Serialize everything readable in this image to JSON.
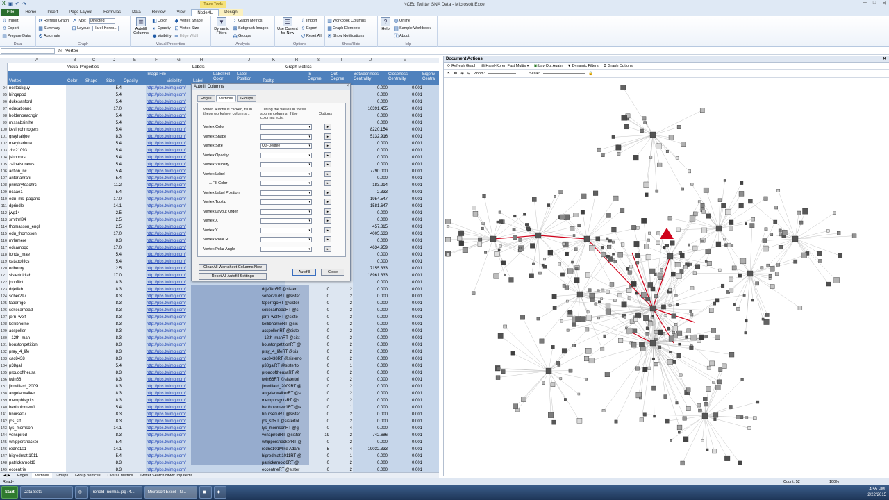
{
  "window": {
    "title": "NCEd Twitter SNA Data - Microsoft Excel",
    "contextual_tab": "Table Tools"
  },
  "ribbon_tabs": [
    "File",
    "Home",
    "Insert",
    "Page Layout",
    "Formulas",
    "Data",
    "Review",
    "View",
    "NodeXL",
    "Design"
  ],
  "ribbon": {
    "data": {
      "import": "Import",
      "export": "Export",
      "prepare": "Prepare Data",
      "name": "Data"
    },
    "graph": {
      "refresh": "Refresh Graph",
      "summary": "Summary",
      "automate": "Automate",
      "type": "Type:",
      "type_value": "Directed",
      "layout": "Layout:",
      "layout_value": "Harel-Koren...",
      "name": "Graph"
    },
    "visual": {
      "autofill": "Autofill Columns",
      "color": "Color",
      "opacity": "Opacity",
      "visibility": "Visibility",
      "shape": "Vertex Shape",
      "size": "Vertex Size",
      "edge_width": "Edge Width",
      "name": "Visual Properties"
    },
    "analysis": {
      "dynamic": "Dynamic Filters",
      "metrics": "Graph Metrics",
      "subgraph": "Subgraph Images",
      "groups": "Groups",
      "name": "Analysis"
    },
    "options": {
      "use_current": "Use Current for New",
      "import": "Import",
      "export": "Export",
      "reset": "Reset All",
      "name": "Options"
    },
    "showhide": {
      "workbook_cols": "Workbook Columns",
      "graph_elems": "Graph Elements",
      "notifications": "Show Notifications",
      "name": "Show/Hide"
    },
    "help": {
      "help": "Help",
      "online": "Online",
      "sample": "Sample Workbook",
      "about": "About",
      "name": "Help"
    }
  },
  "formula_bar": {
    "name_box": "",
    "fx": "fx",
    "value": "Vertex"
  },
  "sheet": {
    "columns": [
      "A",
      "B",
      "C",
      "D",
      "E",
      "F",
      "G",
      "H",
      "I",
      "J",
      "K",
      "R",
      "S",
      "T",
      "U",
      "V"
    ],
    "group_headers": {
      "visual": "Visual Properties",
      "labels": "Labels",
      "metrics": "Graph Metrics"
    },
    "headers": {
      "vertex": "Vertex",
      "color": "Color",
      "shape": "Shape",
      "size": "Size",
      "opacity": "Opacity",
      "image_file": "Image File",
      "visibility": "Visibility",
      "label": "Label",
      "label_fill": "Label Fill Color",
      "label_pos": "Label Position",
      "tooltip": "Tooltip",
      "indegree": "In-Degree",
      "outdegree": "Out-Degree",
      "betweenness": "Betweenness Centrality",
      "closeness": "Closeness Centrality",
      "eigen": "Eigenv Centra"
    },
    "image_url": "http://pbs.twimg.com/",
    "rows": [
      {
        "n": "94",
        "v": "ncstockguy",
        "size": "5.4",
        "btw": "0.000",
        "clo": "0.001"
      },
      {
        "n": "95",
        "v": "bingepod",
        "size": "5.4",
        "btw": "0.000",
        "clo": "0.001"
      },
      {
        "n": "96",
        "v": "dukesanford",
        "size": "5.4",
        "btw": "0.000",
        "clo": "0.001"
      },
      {
        "n": "97",
        "v": "educationnc",
        "size": "17.0",
        "btw": "16391.455",
        "clo": "0.001"
      },
      {
        "n": "98",
        "v": "holdenbeachgirl",
        "size": "5.4",
        "btw": "0.000",
        "clo": "0.001"
      },
      {
        "n": "99",
        "v": "missabsinthe",
        "size": "5.4",
        "btw": "0.000",
        "clo": "0.001"
      },
      {
        "n": "100",
        "v": "kevinjohnrogers",
        "size": "5.4",
        "btw": "8220.154",
        "clo": "0.001"
      },
      {
        "n": "101",
        "v": "grayhairjoe",
        "size": "8.3",
        "btw": "5132.916",
        "clo": "0.001"
      },
      {
        "n": "102",
        "v": "marykarinna",
        "size": "5.4",
        "btw": "0.000",
        "clo": "0.001"
      },
      {
        "n": "103",
        "v": "zbc21093",
        "size": "5.4",
        "btw": "0.000",
        "clo": "0.001"
      },
      {
        "n": "104",
        "v": "jshbooks",
        "size": "5.4",
        "btw": "0.000",
        "clo": "0.001"
      },
      {
        "n": "105",
        "v": "zaibatsunews",
        "size": "5.4",
        "btw": "0.000",
        "clo": "0.001"
      },
      {
        "n": "106",
        "v": "action_nc",
        "size": "5.4",
        "btw": "7790.000",
        "clo": "0.001"
      },
      {
        "n": "107",
        "v": "antarianrani",
        "size": "5.4",
        "btw": "0.000",
        "clo": "0.001"
      },
      {
        "n": "108",
        "v": "primaryteachrc",
        "size": "11.2",
        "btw": "183.214",
        "clo": "0.001"
      },
      {
        "n": "109",
        "v": "ncaae1",
        "size": "5.4",
        "btw": "2.333",
        "clo": "0.001"
      },
      {
        "n": "110",
        "v": "edu_ms_pagano",
        "size": "17.0",
        "btw": "1954.547",
        "clo": "0.001"
      },
      {
        "n": "111",
        "v": "dprindle",
        "size": "14.1",
        "btw": "1581.647",
        "clo": "0.001"
      },
      {
        "n": "112",
        "v": "jwg14",
        "size": "2.5",
        "btw": "0.000",
        "clo": "0.001"
      },
      {
        "n": "113",
        "v": "smithrl34",
        "size": "2.5",
        "btw": "0.000",
        "clo": "0.001"
      },
      {
        "n": "114",
        "v": "thomasson_engl",
        "size": "2.5",
        "btw": "457.815",
        "clo": "0.001"
      },
      {
        "n": "115",
        "v": "edu_thompson",
        "size": "17.0",
        "btw": "4005.633",
        "clo": "0.001"
      },
      {
        "n": "116",
        "v": "mrlamere",
        "size": "8.3",
        "btw": "0.000",
        "clo": "0.001"
      },
      {
        "n": "117",
        "v": "edcampqc",
        "size": "17.0",
        "btw": "4634.959",
        "clo": "0.001"
      },
      {
        "n": "118",
        "v": "fonda_mae",
        "size": "5.4",
        "btw": "0.000",
        "clo": "0.001"
      },
      {
        "n": "119",
        "v": "catspolitics",
        "size": "5.4",
        "btw": "0.000",
        "clo": "0.001"
      },
      {
        "n": "120",
        "v": "edhenry",
        "size": "2.5",
        "btw": "7155.333",
        "clo": "0.001"
      },
      {
        "n": "121",
        "v": "sistertoldjah",
        "size": "17.0",
        "btw": "18961.333",
        "clo": "0.001"
      },
      {
        "n": "122",
        "v": "johnflict",
        "size": "8.3",
        "btw": "0.000",
        "clo": "0.001"
      },
      {
        "n": "123",
        "v": "drjeffeb",
        "size": "8.3",
        "lbl": "drjeffebRT @sister",
        "ind": "0",
        "outd": "2",
        "btw": "0.000",
        "clo": "0.001"
      },
      {
        "n": "124",
        "v": "sober297",
        "size": "8.3",
        "lbl": "sober297RT @sister",
        "ind": "0",
        "outd": "2",
        "btw": "0.000",
        "clo": "0.001"
      },
      {
        "n": "125",
        "v": "faperrigo",
        "size": "8.3",
        "lbl": "faperrigoRT @sister",
        "ind": "0",
        "outd": "2",
        "btw": "0.000",
        "clo": "0.001"
      },
      {
        "n": "126",
        "v": "sokeijarhead",
        "size": "8.3",
        "lbl": "sokeijarheadRT @s",
        "ind": "0",
        "outd": "2",
        "btw": "0.000",
        "clo": "0.001"
      },
      {
        "n": "127",
        "v": "jerri_wolf",
        "size": "8.3",
        "lbl": "jerri_wolfRT @siste",
        "ind": "0",
        "outd": "2",
        "btw": "0.000",
        "clo": "0.001"
      },
      {
        "n": "128",
        "v": "kellibhorne",
        "size": "8.3",
        "lbl": "kellibhorneRT @sis",
        "ind": "0",
        "outd": "2",
        "btw": "0.000",
        "clo": "0.001"
      },
      {
        "n": "129",
        "v": "acspollen",
        "size": "8.3",
        "lbl": "acspollenRT @siste",
        "ind": "0",
        "outd": "2",
        "btw": "0.000",
        "clo": "0.001"
      },
      {
        "n": "130",
        "v": "_12th_man",
        "size": "8.3",
        "lbl": "_12th_manRT @sist",
        "ind": "0",
        "outd": "2",
        "btw": "0.000",
        "clo": "0.001"
      },
      {
        "n": "131",
        "v": "houstonpetition",
        "size": "8.3",
        "lbl": "houstonpetitionRT @",
        "ind": "0",
        "outd": "2",
        "btw": "0.000",
        "clo": "0.001"
      },
      {
        "n": "132",
        "v": "pray_4_life",
        "size": "8.3",
        "lbl": "pray_4_lifeRT @sis",
        "ind": "0",
        "outd": "2",
        "btw": "0.000",
        "clo": "0.001"
      },
      {
        "n": "133",
        "v": "cac8438",
        "size": "8.3",
        "lbl": "cac8438RT @sisterto",
        "ind": "0",
        "outd": "2",
        "btw": "0.000",
        "clo": "0.001"
      },
      {
        "n": "134",
        "v": "p38gal",
        "size": "5.4",
        "lbl": "p38galRT @sistertol",
        "ind": "0",
        "outd": "1",
        "btw": "0.000",
        "clo": "0.001"
      },
      {
        "n": "135",
        "v": "proudoftheusa",
        "size": "8.3",
        "lbl": "proudoftheusaRT @",
        "ind": "0",
        "outd": "2",
        "btw": "0.000",
        "clo": "0.001"
      },
      {
        "n": "136",
        "v": "twin66",
        "size": "8.3",
        "lbl": "twin66RT @sistertol",
        "ind": "0",
        "outd": "2",
        "btw": "0.000",
        "clo": "0.001"
      },
      {
        "n": "137",
        "v": "jimwillard_2009",
        "size": "8.3",
        "lbl": "jimwillard_2009RT @",
        "ind": "0",
        "outd": "2",
        "btw": "0.000",
        "clo": "0.001"
      },
      {
        "n": "138",
        "v": "angelarwalker",
        "size": "8.3",
        "lbl": "angelarwalkerRT @s",
        "ind": "0",
        "outd": "2",
        "btw": "0.000",
        "clo": "0.001"
      },
      {
        "n": "139",
        "v": "memphisgrits",
        "size": "8.3",
        "lbl": "memphisgritsRT @s",
        "ind": "0",
        "outd": "2",
        "btw": "0.000",
        "clo": "0.001"
      },
      {
        "n": "140",
        "v": "bertholomew1",
        "size": "5.4",
        "lbl": "bertholomew1RT @s",
        "ind": "0",
        "outd": "1",
        "btw": "0.000",
        "clo": "0.001"
      },
      {
        "n": "141",
        "v": "hnurse07",
        "size": "8.3",
        "lbl": "hnurse07RT @sister",
        "ind": "0",
        "outd": "2",
        "btw": "0.000",
        "clo": "0.001"
      },
      {
        "n": "142",
        "v": "jcs_sft",
        "size": "8.3",
        "lbl": "jcs_sftRT @sistertol",
        "ind": "0",
        "outd": "2",
        "btw": "0.000",
        "clo": "0.001"
      },
      {
        "n": "143",
        "v": "lys_morrison",
        "size": "14.1",
        "lbl": "lys_morrisonRT @g",
        "ind": "0",
        "outd": "4",
        "btw": "0.000",
        "clo": "0.001"
      },
      {
        "n": "144",
        "v": "venspired",
        "size": "8.3",
        "lbl": "venspiredRT @sister",
        "ind": "19",
        "outd": "2",
        "btw": "742.686",
        "clo": "0.001"
      },
      {
        "n": "145",
        "v": "whippersnacker",
        "size": "5.4",
        "lbl": "whippersnackerRT @",
        "ind": "0",
        "outd": "2",
        "btw": "0.000",
        "clo": "0.001"
      },
      {
        "n": "146",
        "v": "rednc101",
        "size": "14.1",
        "lbl": "rednc101Mike Adam",
        "ind": "5",
        "outd": "4",
        "btw": "19032.333",
        "clo": "0.001"
      },
      {
        "n": "147",
        "v": "bigredmatt1011",
        "size": "5.4",
        "lbl": "bigredmatt1011RT @",
        "ind": "0",
        "outd": "1",
        "btw": "0.000",
        "clo": "0.001"
      },
      {
        "n": "148",
        "v": "patrickarnold6",
        "size": "8.3",
        "lbl": "patrickarnold6RT @",
        "ind": "0",
        "outd": "2",
        "btw": "0.000",
        "clo": "0.001"
      },
      {
        "n": "149",
        "v": "eccentrie",
        "size": "8.3",
        "lbl": "eccentrieRT @sister",
        "ind": "0",
        "outd": "2",
        "btw": "0.000",
        "clo": "0.001"
      }
    ]
  },
  "dialog": {
    "title": "Autofill Columns",
    "close": "×",
    "tabs": [
      "Edges",
      "Vertices",
      "Groups"
    ],
    "col1": "When Autofill is clicked, fill in these worksheet columns...",
    "col2": "...using the values in these source columns, if the columns exist",
    "col3": "Options",
    "fields": [
      {
        "label": "Vertex Color",
        "value": ""
      },
      {
        "label": "Vertex Shape",
        "value": ""
      },
      {
        "label": "Vertex Size",
        "value": "Out-Degree"
      },
      {
        "label": "Vertex Opacity",
        "value": ""
      },
      {
        "label": "Vertex Visibility",
        "value": ""
      },
      {
        "label": "Vertex Label",
        "value": ""
      },
      {
        "label": "...Fill Color",
        "value": ""
      },
      {
        "label": "Vertex Label Position",
        "value": ""
      },
      {
        "label": "Vertex Tooltip",
        "value": ""
      },
      {
        "label": "Vertex Layout Order",
        "value": ""
      },
      {
        "label": "Vertex X",
        "value": ""
      },
      {
        "label": "Vertex Y",
        "value": ""
      },
      {
        "label": "Vertex Polar R",
        "value": ""
      },
      {
        "label": "Vertex Polar Angle",
        "value": ""
      }
    ],
    "clear_btn": "Clear All Worksheet Columns Now",
    "reset_btn": "Reset All Autofill Settings",
    "autofill_btn": "Autofill",
    "close_btn": "Close"
  },
  "sheet_tabs": [
    "Edges",
    "Vertices",
    "Groups",
    "Group Vertices",
    "Overall Metrics",
    "Twitter Search Ntwrk Top Items"
  ],
  "doc_actions": {
    "title": "Document Actions",
    "refresh": "Refresh Graph",
    "layout": "Harel-Koren Fast Multis",
    "lay_out_again": "Lay Out Again",
    "dynamic": "Dynamic Filters",
    "graph_options": "Graph Options",
    "zoom": "Zoom:",
    "scale": "Scale:"
  },
  "status": {
    "ready": "Ready",
    "count": "Count: 52",
    "zoom": "100%"
  },
  "taskbar": {
    "start": "Start",
    "items": [
      "Data Sets",
      "ronald_normal.jpg (4...",
      "Microsoft Excel - N..."
    ],
    "time": "4:55 PM",
    "date": "2/22/2015"
  },
  "colors": {
    "header_blue": "#4f81bd",
    "edge_red": "#d0021b",
    "excel_green": "#2a6e2e"
  }
}
